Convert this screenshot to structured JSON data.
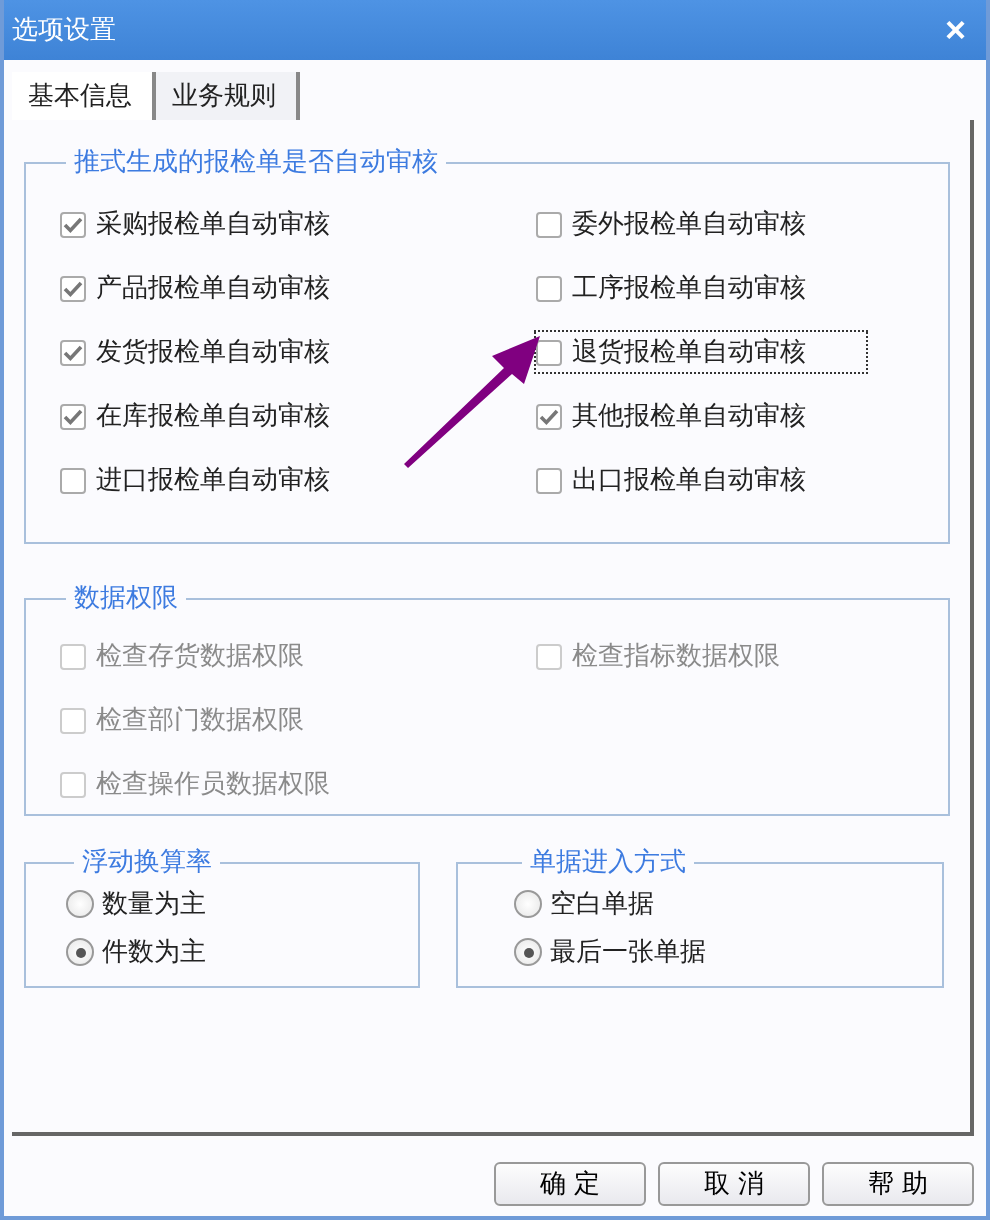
{
  "window": {
    "title": "选项设置",
    "close": "×"
  },
  "tabs": [
    {
      "label": "基本信息",
      "selected": true
    },
    {
      "label": "业务规则",
      "selected": false
    }
  ],
  "groups": [
    {
      "title": "推式生成的报检单是否自动审核",
      "rows": [
        [
          {
            "label": "采购报检单自动审核",
            "checked": true,
            "disabled": false,
            "focused": false
          },
          {
            "label": "委外报检单自动审核",
            "checked": false,
            "disabled": false,
            "focused": false
          }
        ],
        [
          {
            "label": "产品报检单自动审核",
            "checked": true,
            "disabled": false,
            "focused": false
          },
          {
            "label": "工序报检单自动审核",
            "checked": false,
            "disabled": false,
            "focused": false
          }
        ],
        [
          {
            "label": "发货报检单自动审核",
            "checked": true,
            "disabled": false,
            "focused": false
          },
          {
            "label": "退货报检单自动审核",
            "checked": false,
            "disabled": false,
            "focused": true
          }
        ],
        [
          {
            "label": "在库报检单自动审核",
            "checked": true,
            "disabled": false,
            "focused": false
          },
          {
            "label": "其他报检单自动审核",
            "checked": true,
            "disabled": false,
            "focused": false
          }
        ],
        [
          {
            "label": "进口报检单自动审核",
            "checked": false,
            "disabled": false,
            "focused": false
          },
          {
            "label": "出口报检单自动审核",
            "checked": false,
            "disabled": false,
            "focused": false
          }
        ]
      ]
    },
    {
      "title": "数据权限",
      "rows": [
        [
          {
            "label": "检查存货数据权限",
            "checked": false,
            "disabled": true,
            "focused": false
          },
          {
            "label": "检查指标数据权限",
            "checked": false,
            "disabled": true,
            "focused": false
          }
        ],
        [
          {
            "label": "检查部门数据权限",
            "checked": false,
            "disabled": true,
            "focused": false
          }
        ],
        [
          {
            "label": "检查操作员数据权限",
            "checked": false,
            "disabled": true,
            "focused": false
          }
        ]
      ]
    }
  ],
  "radio_groups": [
    {
      "title": "浮动换算率",
      "options": [
        {
          "label": "数量为主",
          "selected": false
        },
        {
          "label": "件数为主",
          "selected": true
        }
      ]
    },
    {
      "title": "单据进入方式",
      "options": [
        {
          "label": "空白单据",
          "selected": false
        },
        {
          "label": "最后一张单据",
          "selected": true
        }
      ]
    }
  ],
  "buttons": [
    "确 定",
    "取 消",
    "帮 助"
  ]
}
